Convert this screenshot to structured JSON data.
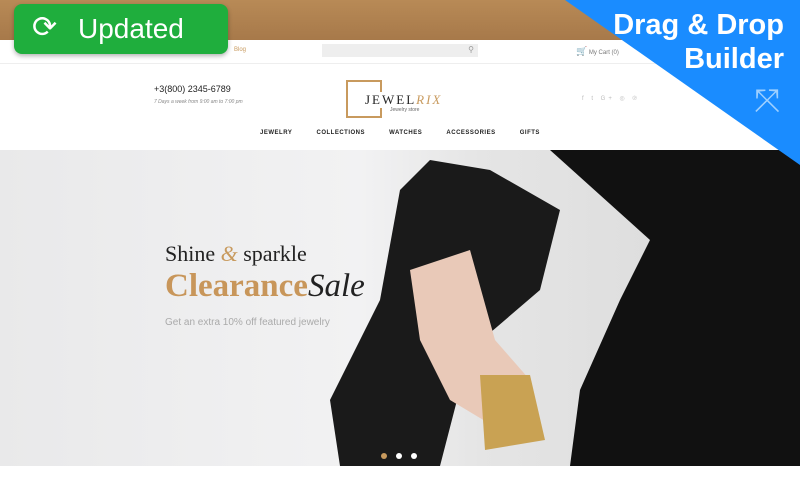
{
  "badge": {
    "label": "Updated",
    "icon": "refresh-icon",
    "color": "#1fae3d"
  },
  "corner": {
    "line1": "Drag & Drop",
    "line2": "Builder",
    "color": "#1a8cff",
    "icon": "move-arrows-icon"
  },
  "topbar": {
    "blog": "Blog",
    "cart": "My Cart (0)"
  },
  "header": {
    "phone": "+3(800) 2345-6789",
    "hours": "7 Days a week from 9:00 am to 7:00 pm",
    "logo_a": "JEWEL",
    "logo_b": "RIX",
    "logo_sub": "Jewelry store",
    "social": "f  t  G+  ◎  ℗"
  },
  "nav": [
    "JEWELRY",
    "COLLECTIONS",
    "WATCHES",
    "ACCESSORIES",
    "GIFTS"
  ],
  "hero": {
    "l1a": "Shine ",
    "l1b": "&",
    "l1c": " sparkle",
    "l2a": "Clearance",
    "l2b": "Sale",
    "l3": "Get an extra 10% off featured jewelry",
    "slides": 3,
    "active": 1
  },
  "accent": "#c89a5e"
}
